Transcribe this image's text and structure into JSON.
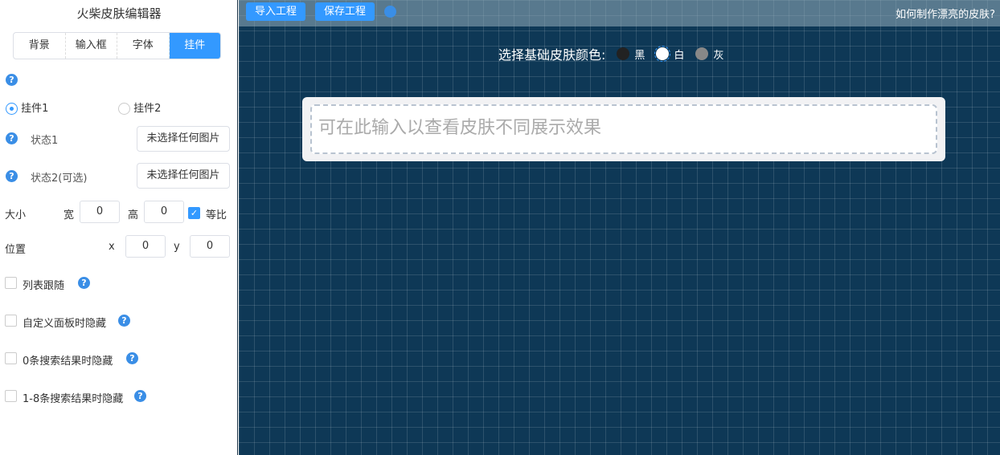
{
  "sidebar": {
    "title": "火柴皮肤编辑器",
    "tabs": [
      "背景",
      "输入框",
      "字体",
      "挂件"
    ],
    "help": "?",
    "widget_radio": [
      "挂件1",
      "挂件2"
    ],
    "state1_label": "状态1",
    "state1_button": "未选择任何图片",
    "state2_label": "状态2(可选)",
    "state2_button": "未选择任何图片",
    "size_label": "大小",
    "width_label": "宽",
    "width_value": "0",
    "height_label": "高",
    "height_value": "0",
    "ratio_label": "等比",
    "ratio_check": "✓",
    "pos_label": "位置",
    "x_label": "x",
    "x_value": "0",
    "y_label": "y",
    "y_value": "0",
    "checks": [
      "列表跟随",
      "自定义面板时隐藏",
      "0条搜索结果时隐藏",
      "1-8条搜索结果时隐藏"
    ]
  },
  "toolbar": {
    "import": "导入工程",
    "save": "保存工程",
    "help": "?",
    "howto": "如何制作漂亮的皮肤?"
  },
  "main": {
    "color_label": "选择基础皮肤颜色:",
    "colors": [
      {
        "label": "黑",
        "hex": "#222222"
      },
      {
        "label": "白",
        "hex": "#ffffff"
      },
      {
        "label": "灰",
        "hex": "#888888"
      }
    ],
    "selected_color": "白",
    "preview_placeholder": "可在此输入以查看皮肤不同展示效果"
  },
  "colors": {
    "accent": "#3399ff",
    "background": "#0e3856"
  }
}
